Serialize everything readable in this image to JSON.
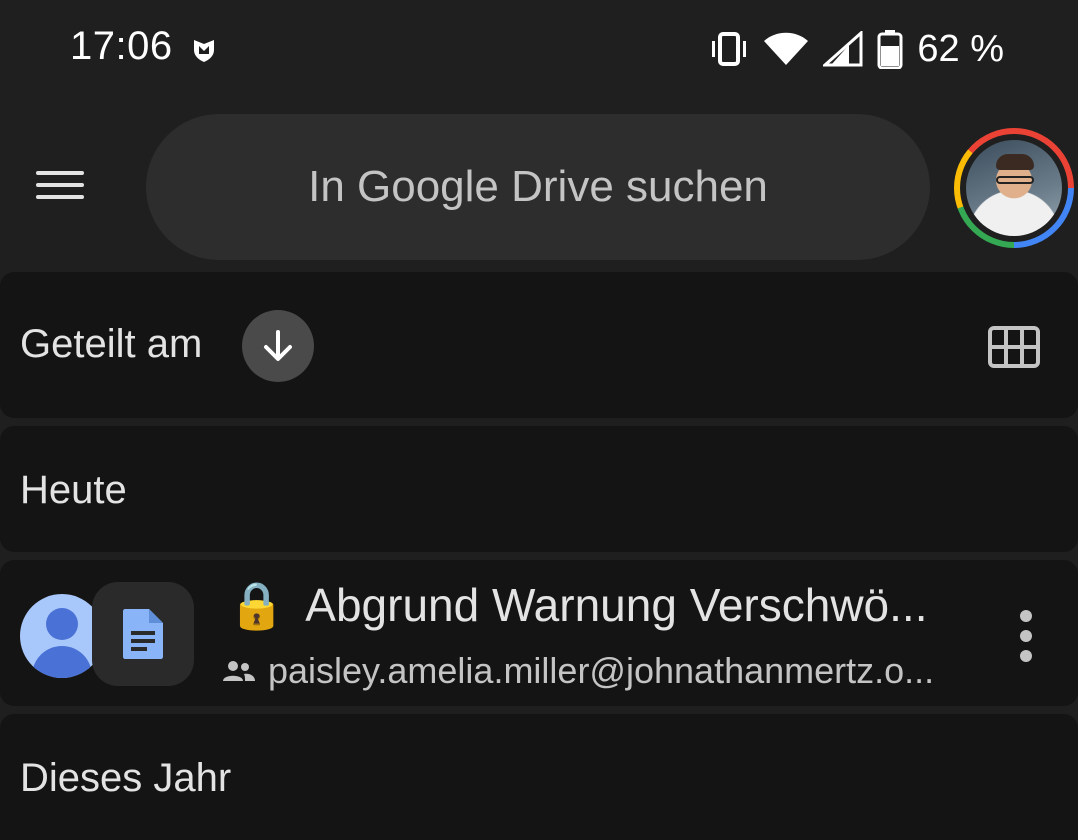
{
  "status_bar": {
    "time": "17:06",
    "battery": "62 %",
    "icons": [
      "shield-notification-icon",
      "vibrate-icon",
      "wifi-icon",
      "cell-signal-icon",
      "battery-icon"
    ]
  },
  "top_bar": {
    "menu_icon": "hamburger-menu-icon",
    "search_placeholder": "In Google Drive suchen",
    "account_icon": "account-avatar"
  },
  "sort_bar": {
    "label": "Geteilt am",
    "direction_icon": "arrow-down-icon",
    "view_toggle_icon": "grid-view-icon"
  },
  "sections": [
    {
      "title": "Heute",
      "files": [
        {
          "lock": "🔒",
          "name": "Abgrund Warnung Verschwö...",
          "owner": "paisley.amelia.miller@johnathanmertz.o...",
          "file_icon": "google-docs-icon",
          "sharer_icon": "person-avatar",
          "shared_icon": "people-icon",
          "more_icon": "more-vert-icon"
        }
      ]
    },
    {
      "title": "Dieses Jahr",
      "files": []
    }
  ],
  "colors": {
    "background": "#1f1f1f",
    "card": "#141414",
    "search_bg": "#2d2d2d",
    "docs_blue": "#8ab4f8",
    "avatar_blue": "#a8c7fa"
  }
}
